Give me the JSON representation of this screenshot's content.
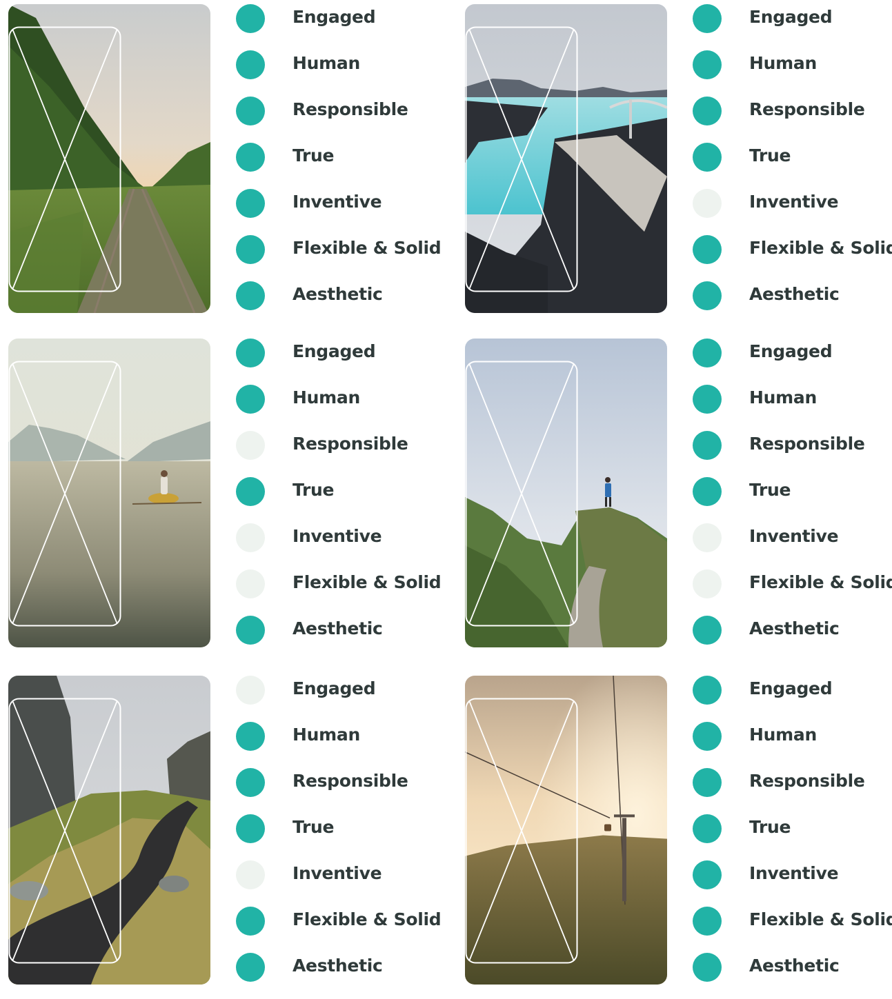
{
  "colors": {
    "active_dot": "#21b3a6",
    "inactive_dot": "#eef3ef",
    "label_text": "#2f3a3a"
  },
  "cards": [
    {
      "photo": "railway-forest",
      "traits": [
        {
          "label": "Engaged",
          "active": true
        },
        {
          "label": "Human",
          "active": true
        },
        {
          "label": "Responsible",
          "active": true
        },
        {
          "label": "True",
          "active": true
        },
        {
          "label": "Inventive",
          "active": true
        },
        {
          "label": "Flexible & Solid",
          "active": true
        },
        {
          "label": "Aesthetic",
          "active": true
        }
      ]
    },
    {
      "photo": "blue-lagoon-boardwalk",
      "traits": [
        {
          "label": "Engaged",
          "active": true
        },
        {
          "label": "Human",
          "active": true
        },
        {
          "label": "Responsible",
          "active": true
        },
        {
          "label": "True",
          "active": true
        },
        {
          "label": "Inventive",
          "active": false
        },
        {
          "label": "Flexible & Solid",
          "active": true
        },
        {
          "label": "Aesthetic",
          "active": true
        }
      ]
    },
    {
      "photo": "lake-rowboat",
      "traits": [
        {
          "label": "Engaged",
          "active": true
        },
        {
          "label": "Human",
          "active": true
        },
        {
          "label": "Responsible",
          "active": false
        },
        {
          "label": "True",
          "active": true
        },
        {
          "label": "Inventive",
          "active": false
        },
        {
          "label": "Flexible & Solid",
          "active": false
        },
        {
          "label": "Aesthetic",
          "active": true
        }
      ]
    },
    {
      "photo": "hiker-on-ridge",
      "traits": [
        {
          "label": "Engaged",
          "active": true
        },
        {
          "label": "Human",
          "active": true
        },
        {
          "label": "Responsible",
          "active": true
        },
        {
          "label": "True",
          "active": true
        },
        {
          "label": "Inventive",
          "active": false
        },
        {
          "label": "Flexible & Solid",
          "active": false
        },
        {
          "label": "Aesthetic",
          "active": true
        }
      ]
    },
    {
      "photo": "canyon-path",
      "traits": [
        {
          "label": "Engaged",
          "active": false
        },
        {
          "label": "Human",
          "active": true
        },
        {
          "label": "Responsible",
          "active": true
        },
        {
          "label": "True",
          "active": true
        },
        {
          "label": "Inventive",
          "active": false
        },
        {
          "label": "Flexible & Solid",
          "active": true
        },
        {
          "label": "Aesthetic",
          "active": true
        }
      ]
    },
    {
      "photo": "cable-car-forest",
      "traits": [
        {
          "label": "Engaged",
          "active": true
        },
        {
          "label": "Human",
          "active": true
        },
        {
          "label": "Responsible",
          "active": true
        },
        {
          "label": "True",
          "active": true
        },
        {
          "label": "Inventive",
          "active": true
        },
        {
          "label": "Flexible & Solid",
          "active": true
        },
        {
          "label": "Aesthetic",
          "active": true
        }
      ]
    }
  ]
}
